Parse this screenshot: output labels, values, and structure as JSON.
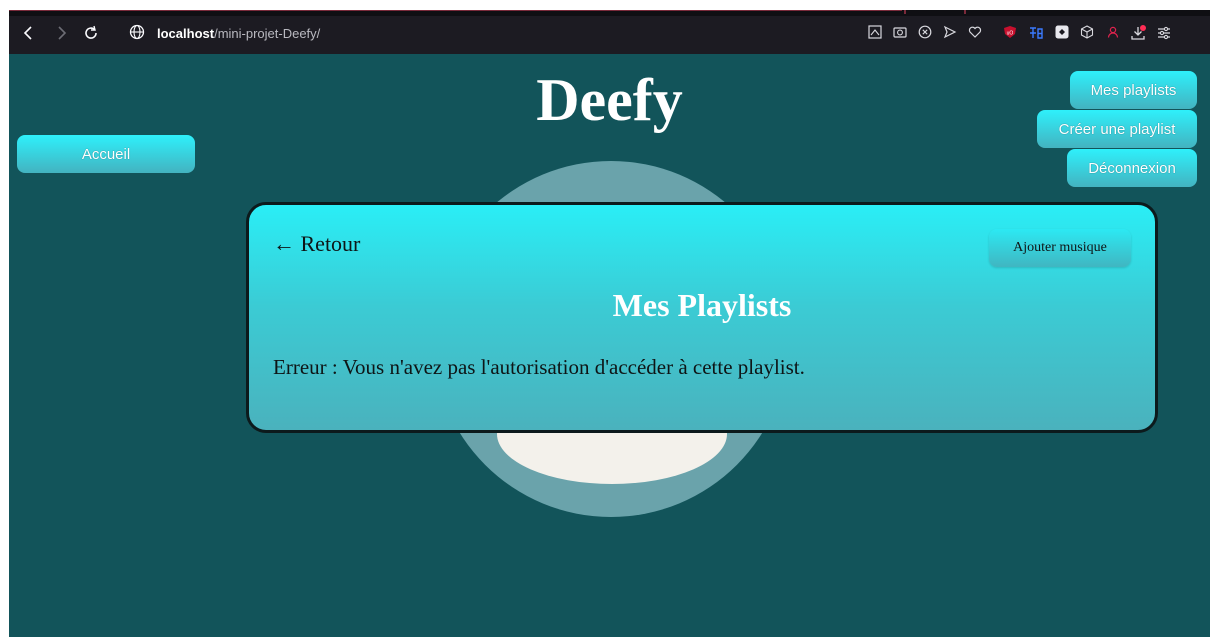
{
  "browser": {
    "url_host": "localhost",
    "url_path": "/mini-projet-Deefy/",
    "icons": [
      "back-icon",
      "forward-icon",
      "reload-icon",
      "globe-icon",
      "screenshot-icon",
      "camera-icon",
      "close-circle-icon",
      "send-icon",
      "heart-icon",
      "ublock-icon",
      "translate-icon",
      "extension-icon",
      "cube-icon",
      "profile-icon",
      "download-icon",
      "menu-icon"
    ]
  },
  "header": {
    "logo": "Deefy",
    "home_button": "Accueil",
    "nav": {
      "my_playlists": "Mes playlists",
      "create_playlist": "Créer une playlist",
      "logout": "Déconnexion"
    }
  },
  "panel": {
    "back_label": "← Retour",
    "add_music_label": "Ajouter musique",
    "title": "Mes Playlists",
    "error_message": "Erreur : Vous n'avez pas l'autorisation d'accéder à cette playlist."
  },
  "colors": {
    "page_bg": "#12545a",
    "accent": "#2ef0fb",
    "chrome_bg": "#1c1b22"
  }
}
